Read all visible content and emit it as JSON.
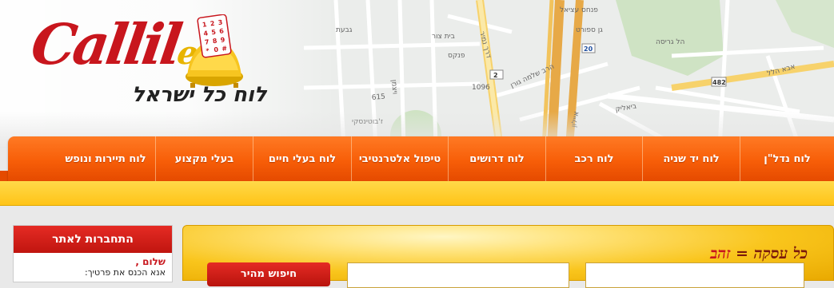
{
  "header": {
    "logo_text": "Callil",
    "logo_tail": "ee",
    "tagline": "לוח כל ישראל",
    "map_labels": [
      "פנקס",
      "דרך נמיר",
      "הרב שלמה גורן",
      "ביאליק",
      "אבא הלל",
      "בית צור",
      "גן ספורט",
      "פנחס עציאל",
      "1096",
      "2",
      "20",
      "482",
      "ויצמן",
      "ז'בוטינסקי",
      "איילון",
      "גבעת",
      "הל גריסה",
      "אבן גבירול"
    ]
  },
  "nav": {
    "items": [
      {
        "label": "לוח נדל\"ן",
        "width": 118
      },
      {
        "label": "לוח יד שניה",
        "width": 122
      },
      {
        "label": "לוח רכב",
        "width": 121
      },
      {
        "label": "לוח דרושים",
        "width": 122
      },
      {
        "label": "טיפול אלטרנטיבי",
        "width": 121
      },
      {
        "label": "לוח בעלי חיים",
        "width": 123
      },
      {
        "label": "בעלי מקצוע",
        "width": 122
      },
      {
        "label": "לוח תיירות ונופש",
        "width": 124
      }
    ]
  },
  "login": {
    "title": "התחברות לאתר",
    "hello": "שלום ,",
    "prompt": "אנא הכנס את פרטיך:"
  },
  "gold_box": {
    "title_part1": "כל עסקה",
    "title_eq": "=",
    "title_part2": "זהב",
    "button_label": "חיפוש מהיר"
  },
  "colors": {
    "nav_orange": "#f75e08",
    "strip_yellow": "#ffc417",
    "brand_red": "#c8161d",
    "gold": "#f9c51c"
  }
}
